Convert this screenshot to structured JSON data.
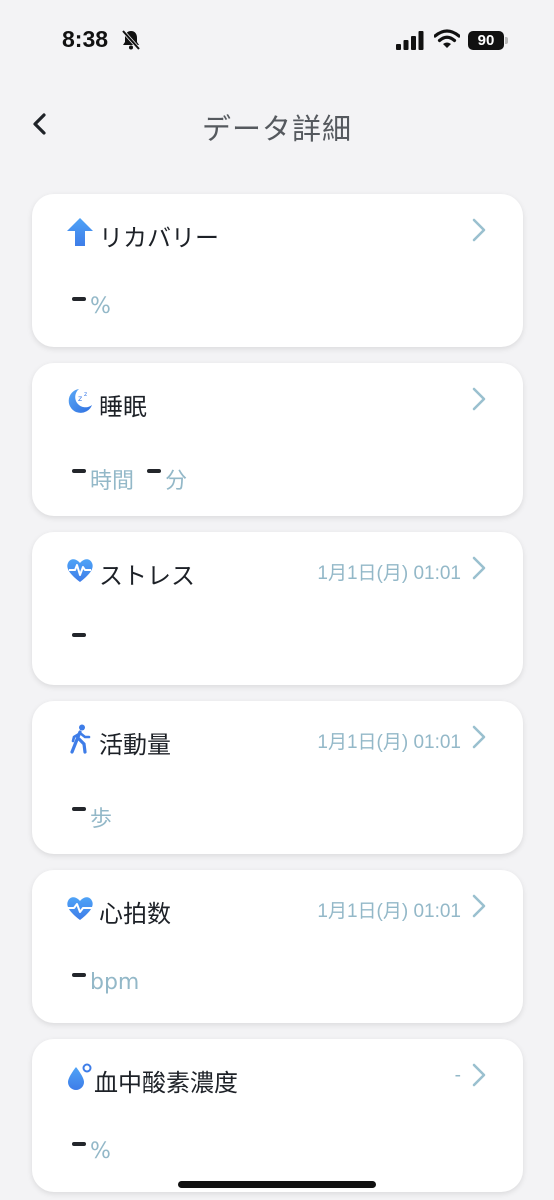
{
  "status_bar": {
    "time": "8:38",
    "battery": "90"
  },
  "header": {
    "title": "データ詳細"
  },
  "cards": [
    {
      "title": "リカバリー",
      "date": "",
      "unit1": "%",
      "unit2": "",
      "icon": "recovery-arrow-icon"
    },
    {
      "title": "睡眠",
      "date": "",
      "unit1": "時間",
      "unit2": "分",
      "icon": "sleep-moon-icon"
    },
    {
      "title": "ストレス",
      "date": "1月1日(月) 01:01",
      "unit1": "",
      "unit2": "",
      "icon": "stress-heart-icon"
    },
    {
      "title": "活動量",
      "date": "1月1日(月) 01:01",
      "unit1": "歩",
      "unit2": "",
      "icon": "walking-person-icon"
    },
    {
      "title": "心拍数",
      "date": "1月1日(月) 01:01",
      "unit1": "bpm",
      "unit2": "",
      "icon": "heart-rate-icon"
    },
    {
      "title": "血中酸素濃度",
      "date": "-",
      "unit1": "%",
      "unit2": "",
      "icon": "blood-oxygen-drop-icon"
    }
  ],
  "colors": {
    "accent": "#4a8ef0",
    "muted_text": "#93b8c8",
    "background": "#f3f3f5"
  }
}
